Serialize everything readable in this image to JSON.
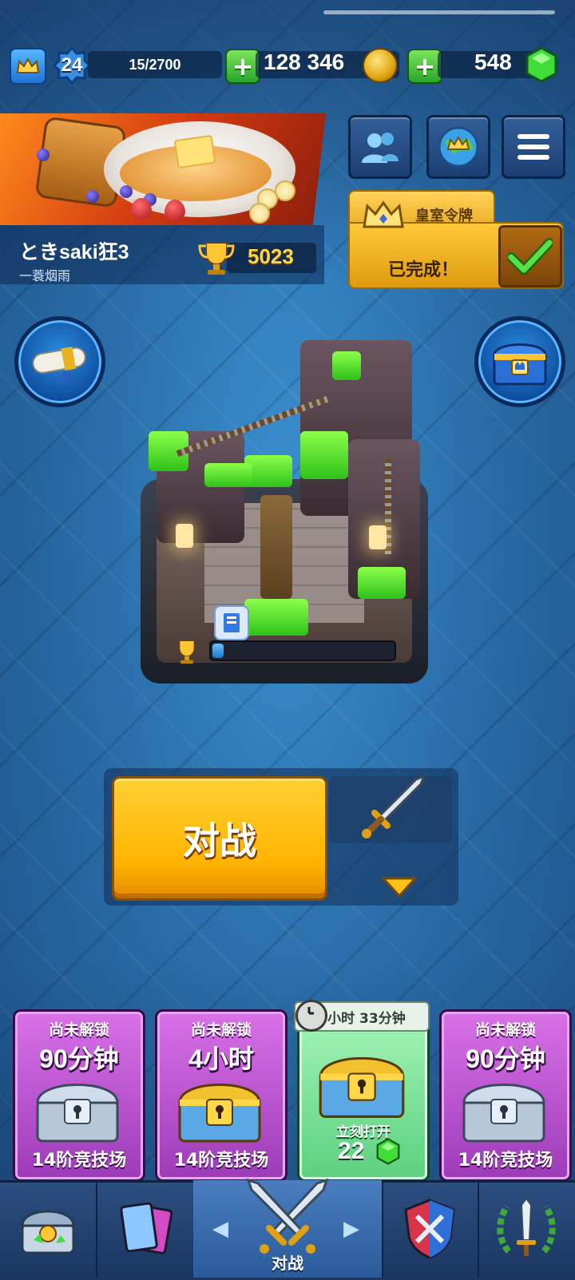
{
  "header": {
    "level": "24",
    "xp": "15/2700",
    "gold": "128 346",
    "gems": "548"
  },
  "profile": {
    "player_name": "ときsaki狂3",
    "clan_name": "一蓑烟雨",
    "trophies": "5023"
  },
  "royal_pass": {
    "title": "皇室令牌",
    "status": "已完成！"
  },
  "arena": {
    "progress_fraction": 0.06
  },
  "battle": {
    "label": "对战"
  },
  "chests": [
    {
      "status": "尚未解锁",
      "time": "90分钟",
      "arena": "14阶竞技场",
      "type": "silver"
    },
    {
      "status": "尚未解锁",
      "time": "4小时",
      "arena": "14阶竞技场",
      "type": "gold"
    },
    {
      "timer": "3小时 33分钟",
      "open_now": "立刻打开",
      "gem_cost": "22",
      "type": "gold"
    },
    {
      "status": "尚未解锁",
      "time": "90分钟",
      "arena": "14阶竞技场",
      "type": "silver"
    }
  ],
  "nav": {
    "battle_label": "对战",
    "left_arrow": "◀",
    "right_arrow": "▶"
  },
  "colors": {
    "battle_button": "#ffb400",
    "chest_locked": "#c25ad8",
    "chest_unlocking": "#7fe39a",
    "gem_green": "#3fdc3a"
  }
}
